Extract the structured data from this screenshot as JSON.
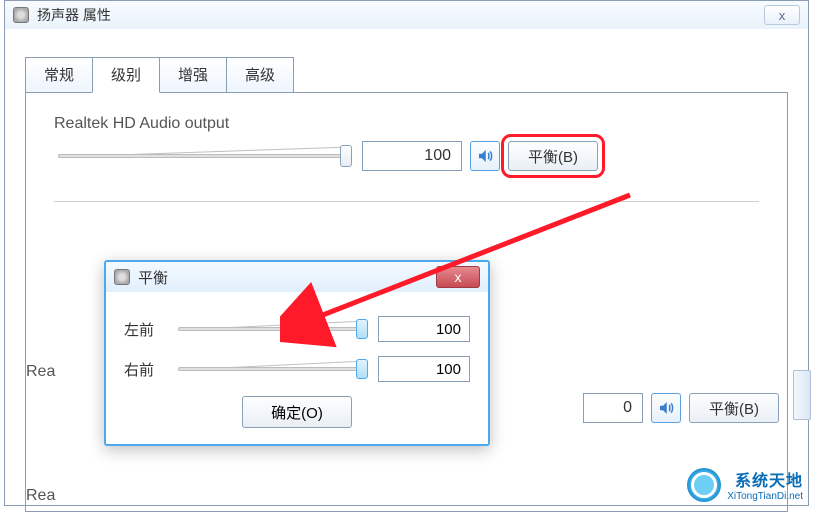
{
  "window": {
    "title": "扬声器 属性",
    "close_glyph": "x"
  },
  "tabs": {
    "general": "常规",
    "levels": "级别",
    "enhance": "增强",
    "advanced": "高级"
  },
  "output1": {
    "label": "Realtek HD Audio output",
    "value": "100",
    "balance_btn": "平衡(B)"
  },
  "output2": {
    "label_partial": "Rea",
    "label_partial2": "Rea",
    "value": "0",
    "balance_btn": "平衡(B)"
  },
  "balance_dialog": {
    "title": "平衡",
    "close_glyph": "x",
    "left_front": {
      "label": "左前",
      "value": "100"
    },
    "right_front": {
      "label": "右前",
      "value": "100"
    },
    "ok_btn": "确定(O)"
  },
  "watermark": {
    "line1": "系统天地",
    "line2": "XiTongTianDi.net"
  }
}
